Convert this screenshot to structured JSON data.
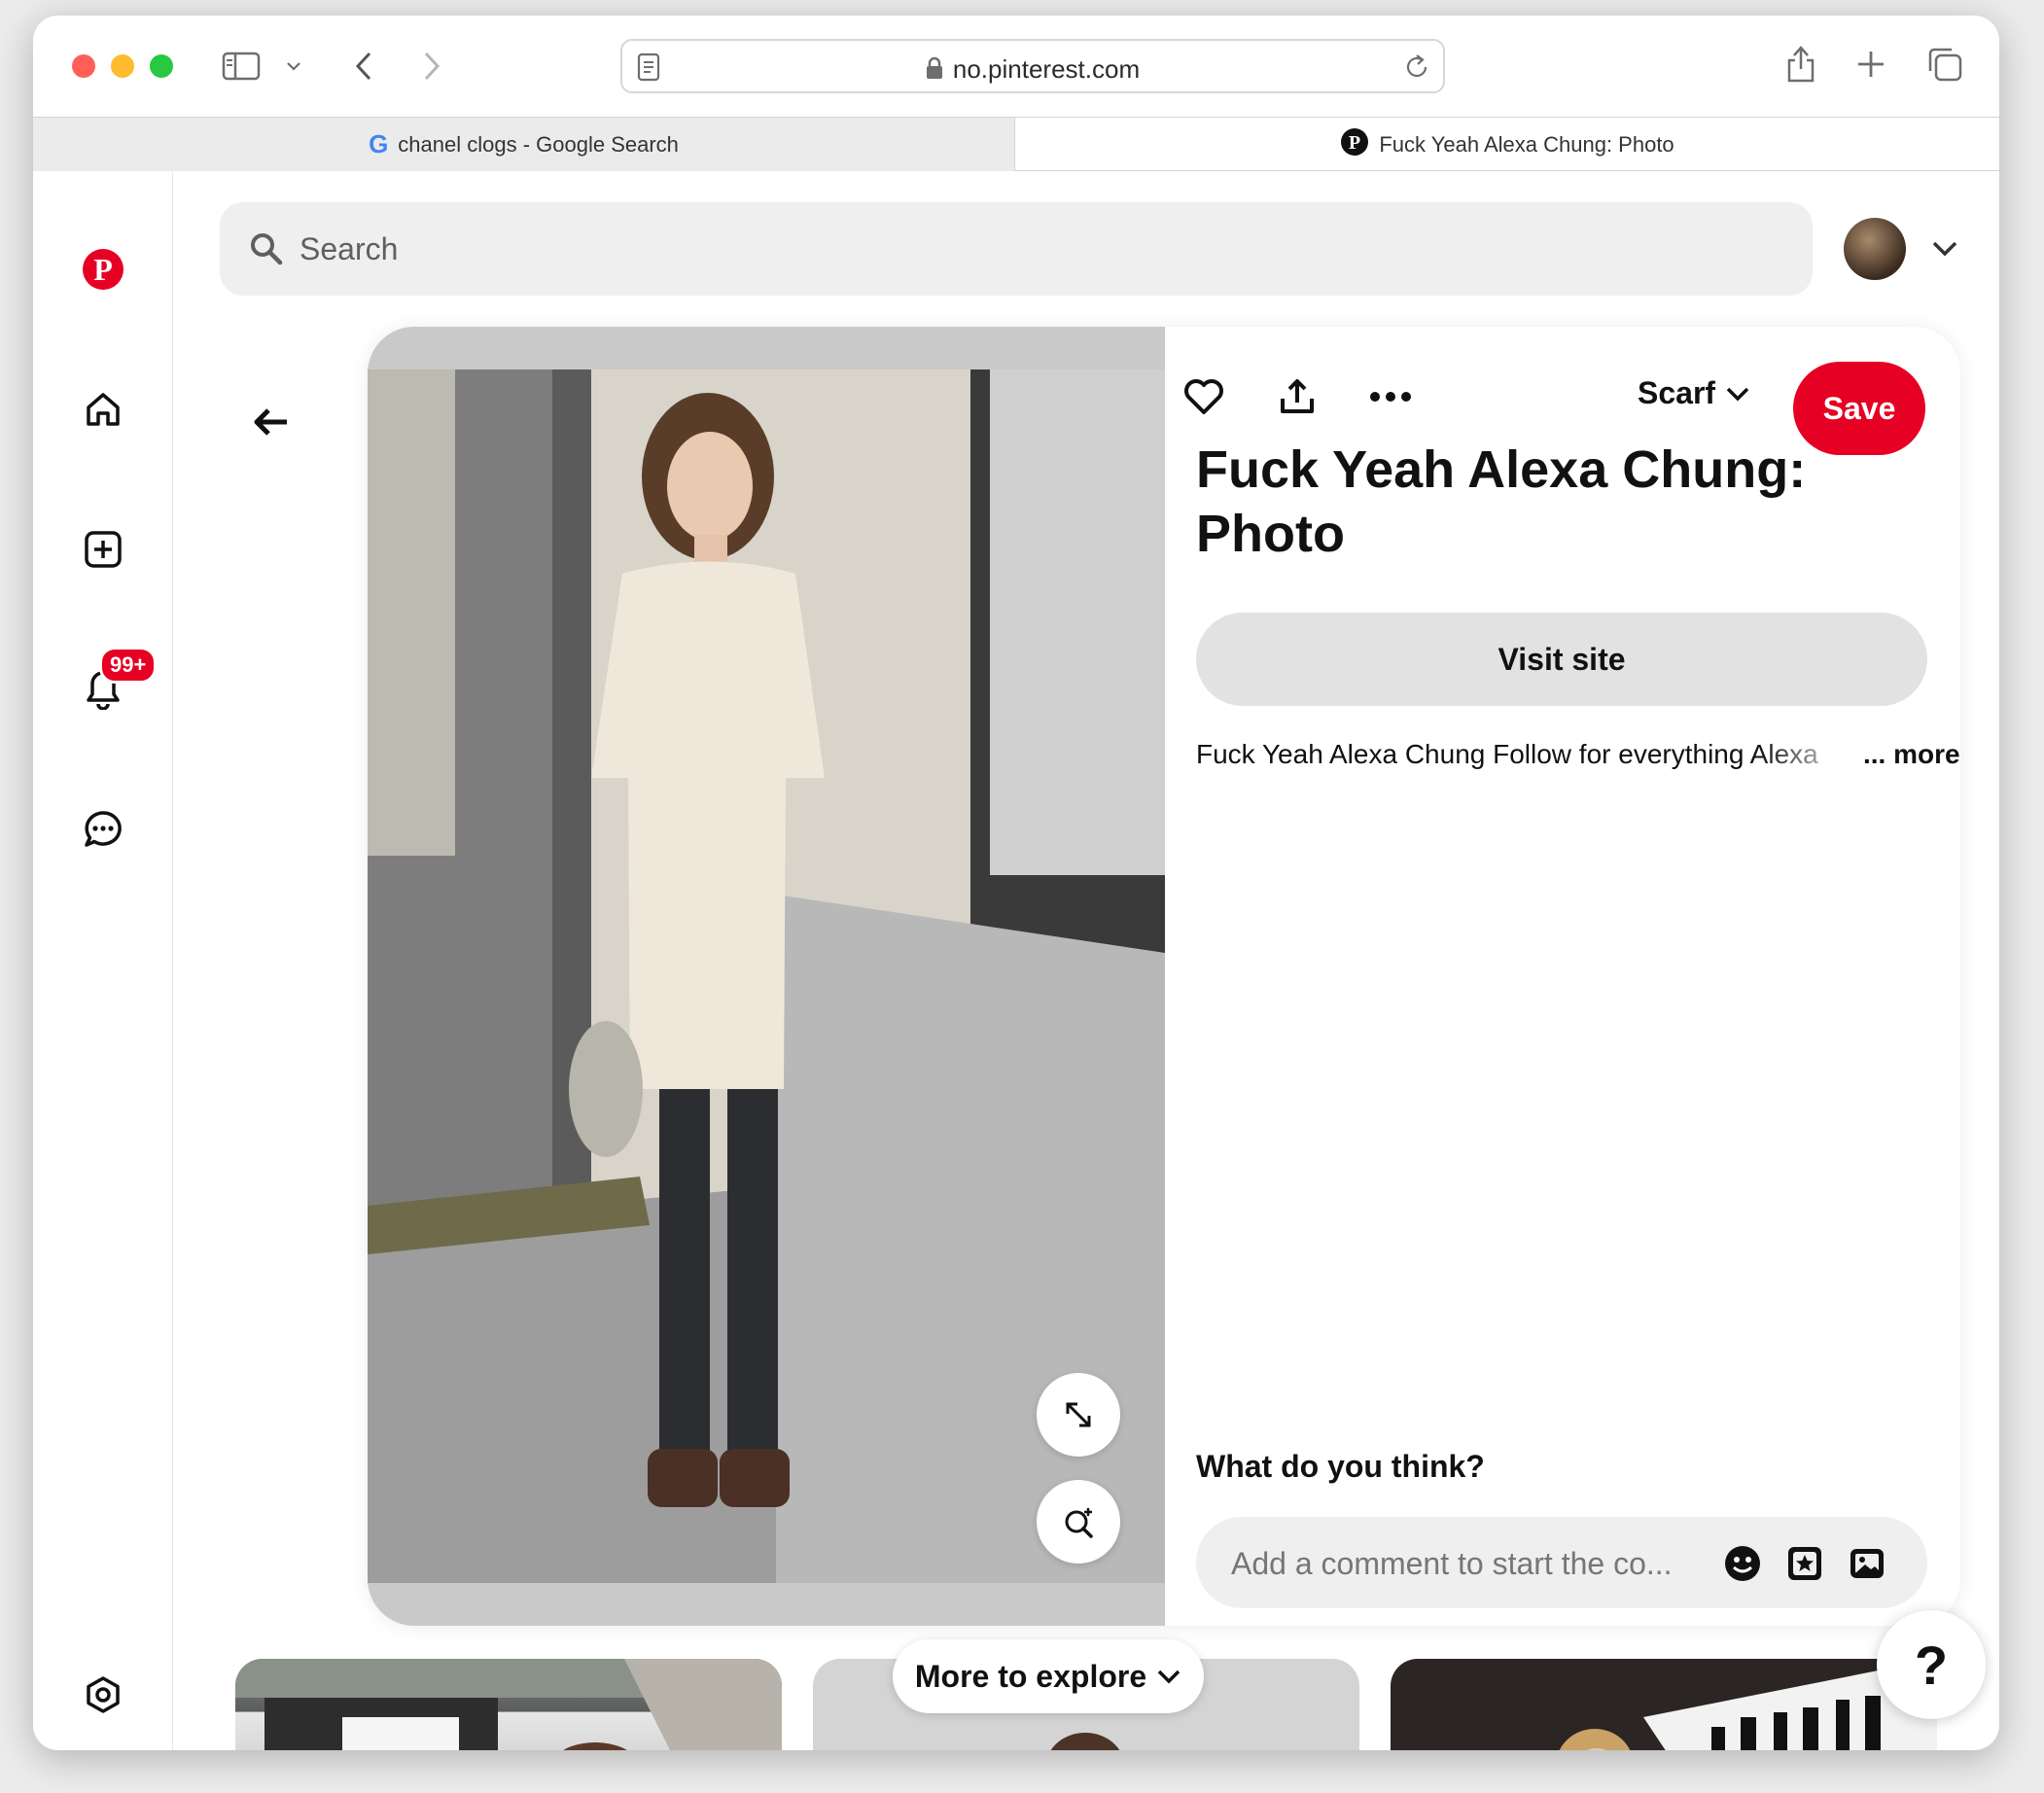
{
  "browser": {
    "url": "no.pinterest.com",
    "tabs": [
      {
        "label": "chanel clogs - Google Search",
        "active": false
      },
      {
        "label": "Fuck Yeah Alexa Chung: Photo",
        "active": true
      }
    ]
  },
  "search": {
    "placeholder": "Search"
  },
  "notifications": {
    "badge": "99+"
  },
  "pin": {
    "board": "Scarf",
    "save_label": "Save",
    "title": "Fuck Yeah Alexa Chung: Photo",
    "visit_label": "Visit site",
    "description": "Fuck Yeah Alexa Chung Follow for everything Alexa",
    "more_label": "... more",
    "comment_prompt": "What do you think?",
    "comment_placeholder": "Add a comment to start the co..."
  },
  "explore": {
    "label": "More to explore"
  },
  "help": {
    "label": "?"
  },
  "colors": {
    "brand": "#e60023",
    "traffic_red": "#ff5f57",
    "traffic_yellow": "#febc2e",
    "traffic_green": "#28c840"
  }
}
